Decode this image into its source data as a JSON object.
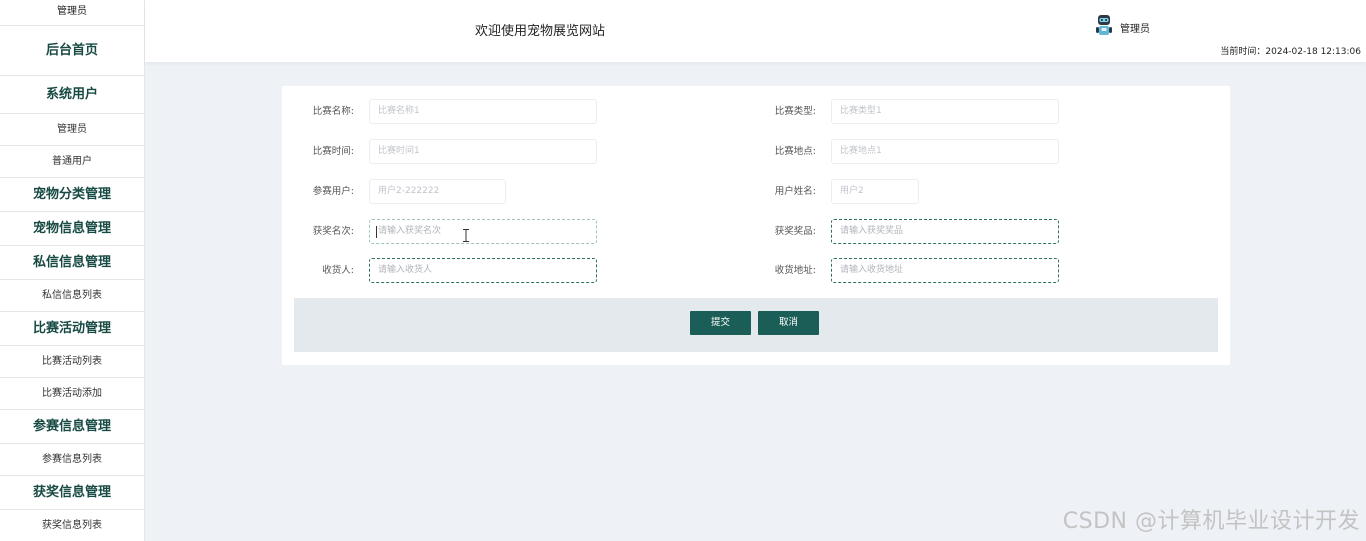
{
  "sidebar": {
    "role": "管理员",
    "home": "后台首页",
    "groups": [
      {
        "title": "系统用户",
        "items": [
          "管理员",
          "普通用户"
        ]
      },
      {
        "title": "宠物分类管理",
        "items": []
      },
      {
        "title": "宠物信息管理",
        "items": []
      },
      {
        "title": "私信信息管理",
        "items": [
          "私信信息列表"
        ]
      },
      {
        "title": "比赛活动管理",
        "items": [
          "比赛活动列表",
          "比赛活动添加"
        ]
      },
      {
        "title": "参赛信息管理",
        "items": [
          "参赛信息列表"
        ]
      },
      {
        "title": "获奖信息管理",
        "items": [
          "获奖信息列表"
        ]
      }
    ]
  },
  "header": {
    "title": "欢迎使用宠物展览网站",
    "user": "管理员",
    "time_label": "当前时间：",
    "time_value": "2024-02-18 12:13:06",
    "avatar_icon": "robot-avatar-icon"
  },
  "form": {
    "match_name": {
      "label": "比赛名称:",
      "placeholder": "比赛名称1"
    },
    "match_type": {
      "label": "比赛类型:",
      "placeholder": "比赛类型1"
    },
    "match_time": {
      "label": "比赛时间:",
      "placeholder": "比赛时间1"
    },
    "match_place": {
      "label": "比赛地点:",
      "placeholder": "比赛地点1"
    },
    "participant": {
      "label": "参赛用户:",
      "placeholder": "用户2-222222"
    },
    "user_name": {
      "label": "用户姓名:",
      "placeholder": "用户2"
    },
    "award_rank": {
      "label": "获奖名次:",
      "placeholder": "请输入获奖名次"
    },
    "award_prize": {
      "label": "获奖奖品:",
      "placeholder": "请输入获奖奖品"
    },
    "receiver": {
      "label": "收货人:",
      "placeholder": "请输入收货人"
    },
    "address": {
      "label": "收货地址:",
      "placeholder": "请输入收货地址"
    },
    "submit": "提交",
    "cancel": "取消"
  },
  "watermark": "CSDN @计算机毕业设计开发",
  "colors": {
    "accent": "#1b5e57",
    "sidebar_text": "#184a44",
    "background": "#eef1f6"
  }
}
